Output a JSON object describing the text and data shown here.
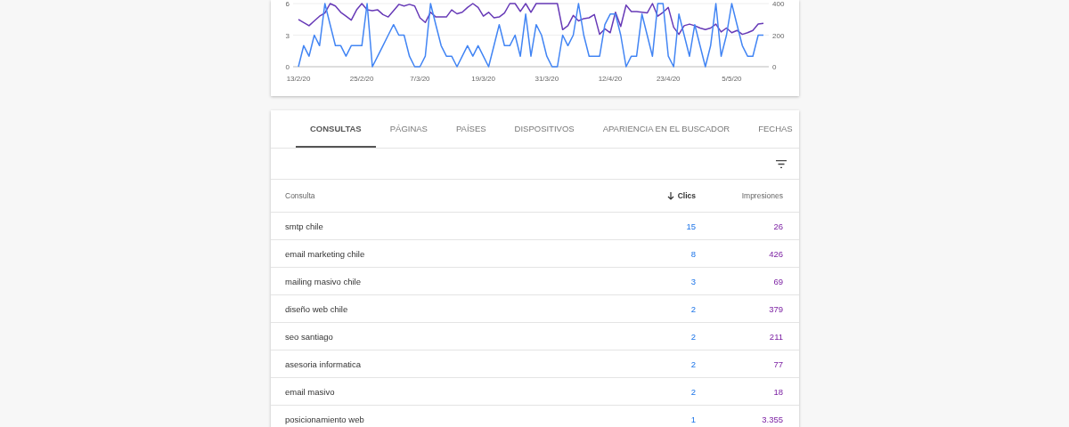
{
  "performance_chart": {
    "chart_data": {
      "type": "line",
      "ylim": [
        0,
        6
      ],
      "yticks": [
        0,
        3,
        6
      ],
      "y2lim": [
        0,
        400
      ],
      "y2ticks": [
        0,
        200,
        400
      ],
      "categories": [
        "13/2/20",
        null,
        null,
        null,
        null,
        null,
        null,
        null,
        null,
        null,
        null,
        null,
        "25/2/20",
        null,
        null,
        null,
        null,
        null,
        null,
        null,
        null,
        null,
        null,
        "7/3/20",
        null,
        null,
        null,
        null,
        null,
        null,
        null,
        null,
        null,
        null,
        null,
        "19/3/20",
        null,
        null,
        null,
        null,
        null,
        null,
        null,
        null,
        null,
        null,
        null,
        "31/3/20",
        null,
        null,
        null,
        null,
        null,
        null,
        null,
        null,
        null,
        null,
        null,
        "12/4/20",
        null,
        null,
        null,
        null,
        null,
        null,
        null,
        null,
        null,
        null,
        "23/4/20",
        null,
        null,
        null,
        null,
        null,
        null,
        null,
        null,
        null,
        null,
        null,
        "5/5/20",
        null,
        null,
        null,
        null,
        null,
        null
      ],
      "series": [
        {
          "color": "#673ab7",
          "axis": "y2",
          "values": [
            300,
            280,
            260,
            290,
            320,
            340,
            400,
            385,
            345,
            320,
            295,
            360,
            400,
            360,
            355,
            360,
            330,
            315,
            355,
            395,
            385,
            395,
            385,
            310,
            280,
            345,
            315,
            315,
            315,
            360,
            335,
            345,
            375,
            400,
            375,
            320,
            345,
            310,
            315,
            340,
            400,
            400,
            350,
            400,
            345,
            400,
            400,
            400,
            400,
            400,
            235,
            260,
            325,
            290,
            305,
            310,
            330,
            205,
            240,
            215,
            345,
            255,
            390,
            350,
            350,
            345,
            340,
            400,
            320,
            345,
            375,
            250,
            205,
            260,
            270,
            260,
            245,
            235,
            245,
            270,
            220,
            245,
            215,
            230,
            205,
            215,
            230,
            270,
            275
          ]
        },
        {
          "color": "#4285f4",
          "values": [
            0,
            2,
            1,
            3,
            2,
            6,
            4,
            2,
            2,
            1,
            2,
            2,
            2,
            6,
            0,
            1,
            2,
            3,
            4,
            3,
            3,
            1,
            0,
            0,
            1,
            6,
            4,
            2,
            1,
            1,
            0,
            1,
            2,
            1,
            2,
            1,
            0,
            2,
            4,
            2,
            2,
            3,
            1,
            5,
            1,
            4,
            3,
            1,
            0,
            0,
            3,
            2,
            3,
            6,
            3,
            1,
            1,
            1,
            4,
            5,
            5,
            3,
            0,
            1,
            1,
            5,
            3,
            1,
            6,
            6,
            1,
            0,
            5,
            3,
            1,
            4,
            2,
            0,
            2,
            6,
            1,
            3,
            6,
            4,
            2,
            1,
            1,
            3,
            3
          ]
        }
      ]
    }
  },
  "tabs": [
    {
      "label": "CONSULTAS",
      "selected": true
    },
    {
      "label": "PÁGINAS",
      "selected": false
    },
    {
      "label": "PAÍSES",
      "selected": false
    },
    {
      "label": "DISPOSITIVOS",
      "selected": false
    },
    {
      "label": "APARIENCIA EN EL BUSCADOR",
      "selected": false
    },
    {
      "label": "FECHAS",
      "selected": false
    }
  ],
  "table": {
    "columns": [
      {
        "label": "Consulta",
        "kind": "text",
        "sorted": false
      },
      {
        "label": "Clics",
        "kind": "clicks",
        "sorted": true
      },
      {
        "label": "Impresiones",
        "kind": "impressions",
        "sorted": false
      }
    ],
    "rows": [
      [
        "smtp chile",
        "15",
        "26"
      ],
      [
        "email marketing chile",
        "8",
        "426"
      ],
      [
        "mailing masivo chile",
        "3",
        "69"
      ],
      [
        "diseño web chile",
        "2",
        "379"
      ],
      [
        "seo santiago",
        "2",
        "211"
      ],
      [
        "asesoria informatica",
        "2",
        "77"
      ],
      [
        "email masivo",
        "2",
        "18"
      ],
      [
        "posicionamiento web",
        "1",
        "3.355"
      ]
    ]
  }
}
